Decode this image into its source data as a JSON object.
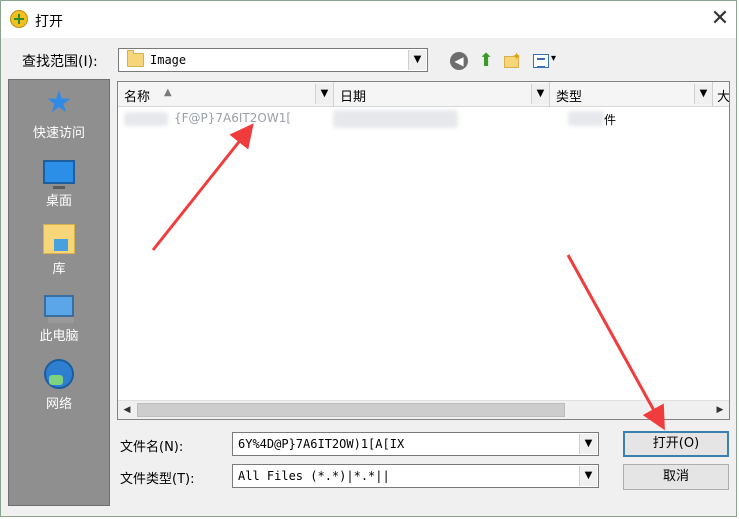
{
  "window": {
    "title": "打开",
    "close_glyph": "✕"
  },
  "toolbar": {
    "lookin_label": "查找范围(I):",
    "lookin_value": "Image",
    "combo_arrow": "▼",
    "back_glyph": "◀",
    "up_glyph": "⬆",
    "newfolder_glyph": "✦",
    "view_arrow": "▾",
    "icons": [
      "back-icon",
      "up-folder-icon",
      "new-folder-icon",
      "view-menu-icon"
    ]
  },
  "places": [
    {
      "label": "快速访问",
      "icon": "star-icon"
    },
    {
      "label": "桌面",
      "icon": "desktop-icon"
    },
    {
      "label": "库",
      "icon": "library-icon"
    },
    {
      "label": "此电脑",
      "icon": "computer-icon"
    },
    {
      "label": "网络",
      "icon": "network-icon"
    }
  ],
  "list": {
    "columns": [
      {
        "label": "名称",
        "sort": "▲"
      },
      {
        "label": "日期"
      },
      {
        "label": "类型"
      },
      {
        "label": "大"
      }
    ],
    "drop_glyph": "▼",
    "file": {
      "name": "{F@P}7A6IT2OW1[",
      "type": "件"
    },
    "scroll_left": "◀",
    "scroll_right": "▶"
  },
  "filename": {
    "label": "文件名(N):",
    "value": "6Y%4D@P}7A6IT2OW)1[A[IX"
  },
  "filetype": {
    "label": "文件类型(T):",
    "value": "All Files (*.*)|*.*||"
  },
  "buttons": {
    "open": "打开(O)",
    "cancel": "取消"
  },
  "accent_colors": {
    "annotation_arrow": "#f03c3c",
    "open_button_border": "#3c7fb1"
  }
}
